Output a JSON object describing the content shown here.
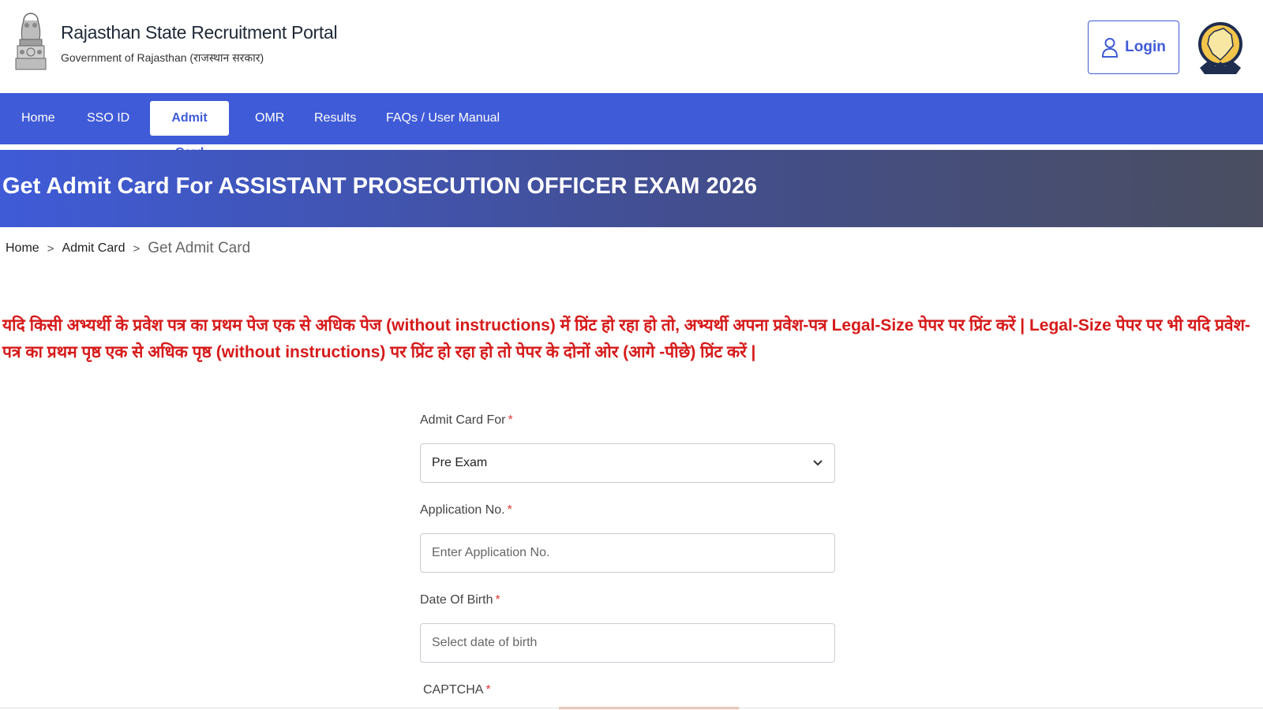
{
  "header": {
    "title": "Rajasthan State Recruitment Portal",
    "subtitle": "Government of Rajasthan (राजस्थान सरकार)",
    "login_label": "Login"
  },
  "nav": {
    "items": [
      "Home",
      "SSO ID",
      "Admit Card",
      "OMR",
      "Results",
      "FAQs / User Manual"
    ],
    "active_index": 2
  },
  "banner": {
    "title": "Get Admit Card For ASSISTANT PROSECUTION OFFICER EXAM 2026"
  },
  "breadcrumb": {
    "items": [
      "Home",
      "Admit Card",
      "Get Admit Card"
    ],
    "separator": ">"
  },
  "notice": {
    "text": "यदि किसी अभ्यर्थी के प्रवेश पत्र का प्रथम पेज एक से अधिक पेज (without instructions) में प्रिंट हो रहा हो तो, अभ्यर्थी अपना प्रवेश-पत्र Legal-Size पेपर पर प्रिंट करें | Legal-Size पेपर पर भी यदि प्रवेश-पत्र का प्रथम पृष्ठ एक से अधिक पृष्ठ (without instructions) पर प्रिंट हो रहा हो तो पेपर के दोनों ओर (आगे -पीछे) प्रिंट करें |",
    "color": "#d61a1a"
  },
  "form": {
    "admit_card_for": {
      "label": "Admit Card For",
      "value": "Pre Exam"
    },
    "application_no": {
      "label": "Application No.",
      "placeholder": "Enter Application No.",
      "value": ""
    },
    "dob": {
      "label": "Date Of Birth",
      "placeholder": "Select date of birth",
      "value": ""
    },
    "captcha": {
      "label": "CAPTCHA"
    },
    "required_mark": "*"
  },
  "colors": {
    "primary": "#3f5bd7",
    "required": "#e53935",
    "notice": "#d61a1a"
  },
  "icons": {
    "emblem": "national-emblem-icon",
    "login": "user-icon",
    "logo": "rajasthan-map-logo",
    "dropdown": "chevron-down-icon"
  }
}
